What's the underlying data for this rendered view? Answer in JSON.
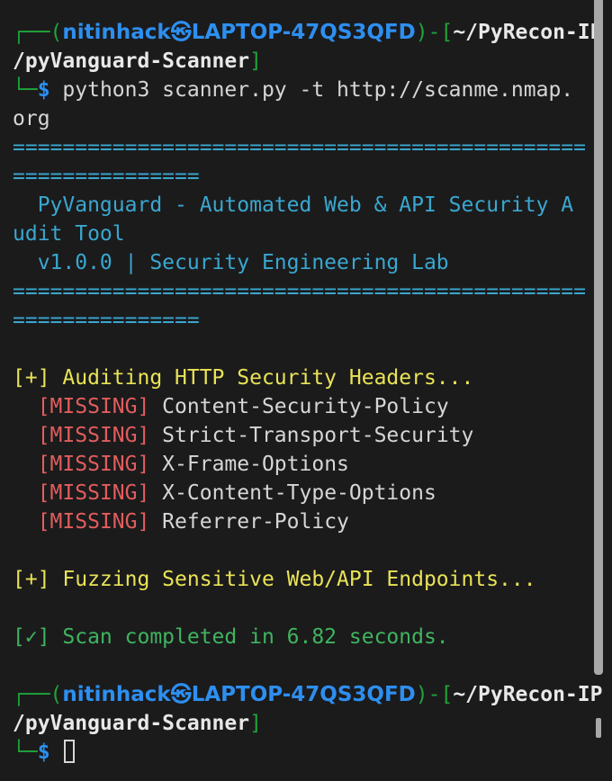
{
  "prompt1": {
    "corner_top": "┌──(",
    "user_host": "nitinhack㉿LAPTOP-47QS3QFD",
    "mid": ")-[",
    "path_part1": "~/PyRecon-IP",
    "path_part2": "/pyVanguard-Scanner",
    "close": "]",
    "corner_bottom": "└─",
    "dollar": "$",
    "command_part1": " python3 scanner.py -t http://scanme.nmap.",
    "command_part2": "org"
  },
  "banner": {
    "rule_a1": "==============================================",
    "rule_a2": "===============",
    "title_part1": "  PyVanguard - Automated Web & API Security A",
    "title_part2": "udit Tool",
    "version": "  v1.0.0 | Security Engineering Lab",
    "rule_b1": "==============================================",
    "rule_b2": "==============="
  },
  "headers_section": {
    "heading": "[+] Auditing HTTP Security Headers...",
    "items": [
      {
        "tag": "[MISSING]",
        "name": " Content-Security-Policy"
      },
      {
        "tag": "[MISSING]",
        "name": " Strict-Transport-Security"
      },
      {
        "tag": "[MISSING]",
        "name": " X-Frame-Options"
      },
      {
        "tag": "[MISSING]",
        "name": " X-Content-Type-Options"
      },
      {
        "tag": "[MISSING]",
        "name": " Referrer-Policy"
      }
    ]
  },
  "fuzz_section": {
    "heading": "[+] Fuzzing Sensitive Web/API Endpoints..."
  },
  "completion": {
    "text": "[✓] Scan completed in 6.82 seconds."
  },
  "prompt2": {
    "corner_top": "┌──(",
    "user_host": "nitinhack㉿LAPTOP-47QS3QFD",
    "mid": ")-[",
    "path_part1": "~/PyRecon-IP",
    "path_part2": "/pyVanguard-Scanner",
    "close": "]",
    "corner_bottom": "└─",
    "dollar": "$"
  },
  "colors": {
    "background": "#1b1b1c",
    "prompt_frame": "#1fa339",
    "user_host": "#2d8ff0",
    "banner": "#3aa7cf",
    "heading": "#e9e356",
    "missing": "#e25d5d",
    "success": "#3fb45f"
  }
}
